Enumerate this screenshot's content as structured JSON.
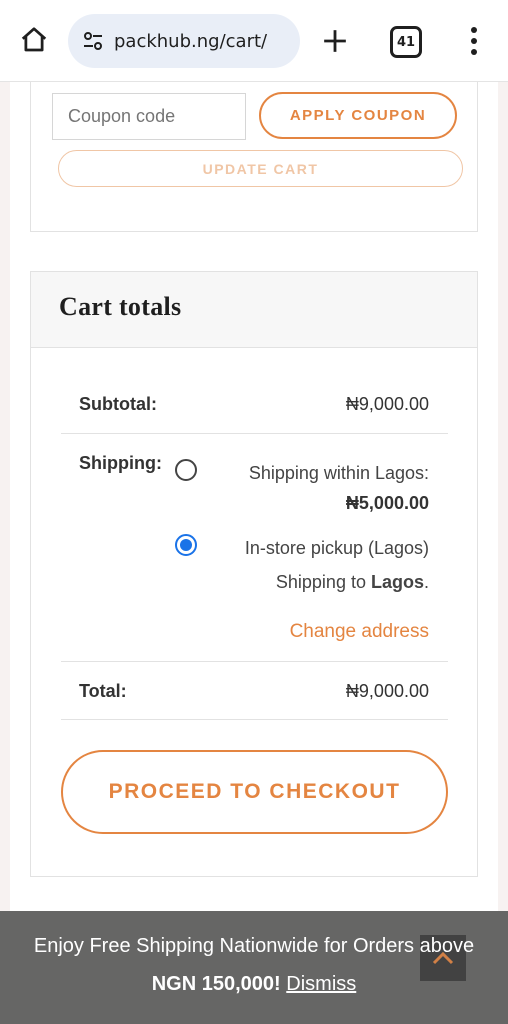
{
  "browser": {
    "url": "packhub.ng/cart/",
    "tab_count": "41"
  },
  "coupon": {
    "placeholder": "Coupon code",
    "apply_label": "APPLY COUPON",
    "update_label": "UPDATE CART"
  },
  "cart_totals": {
    "title": "Cart totals",
    "subtotal_label": "Subtotal:",
    "subtotal_value": "₦9,000.00",
    "shipping_label": "Shipping:",
    "shipping_options": [
      {
        "label": "Shipping within Lagos:",
        "price": "₦5,000.00",
        "selected": false
      },
      {
        "label": "In-store pickup (Lagos)",
        "selected": true
      }
    ],
    "shipping_to_prefix": "Shipping to ",
    "shipping_to_location": "Lagos",
    "shipping_to_suffix": ".",
    "change_address": "Change address",
    "total_label": "Total:",
    "total_value": "₦9,000.00",
    "checkout_label": "PROCEED TO CHECKOUT"
  },
  "notice": {
    "line1": "Enjoy Free Shipping Nationwide for Orders above",
    "line2_bold": "NGN 150,000!",
    "dismiss": "Dismiss"
  },
  "colors": {
    "accent": "#e48541",
    "radio_selected": "#1a73e8",
    "notice_bg": "#666665"
  }
}
